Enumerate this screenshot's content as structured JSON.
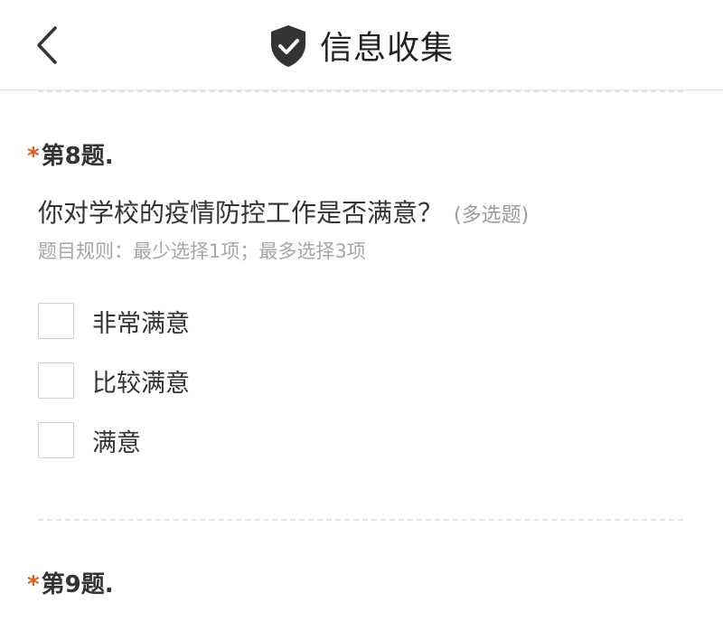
{
  "header": {
    "title": "信息收集",
    "back_icon": "chevron-left-icon",
    "title_icon": "shield-check-icon"
  },
  "questions": [
    {
      "number_label": "第8题.",
      "required_mark": "*",
      "text": "你对学校的疫情防控工作是否满意？",
      "type_label": "(多选题)",
      "rule": "题目规则：最少选择1项；最多选择3项",
      "options": [
        {
          "label": "非常满意",
          "checked": false
        },
        {
          "label": "比较满意",
          "checked": false
        },
        {
          "label": "满意",
          "checked": false
        }
      ]
    },
    {
      "number_label": "第9题.",
      "required_mark": "*"
    }
  ],
  "colors": {
    "required": "#e05a1c",
    "text": "#333333",
    "muted": "#a6a6a6",
    "divider": "#e4e4e4"
  }
}
